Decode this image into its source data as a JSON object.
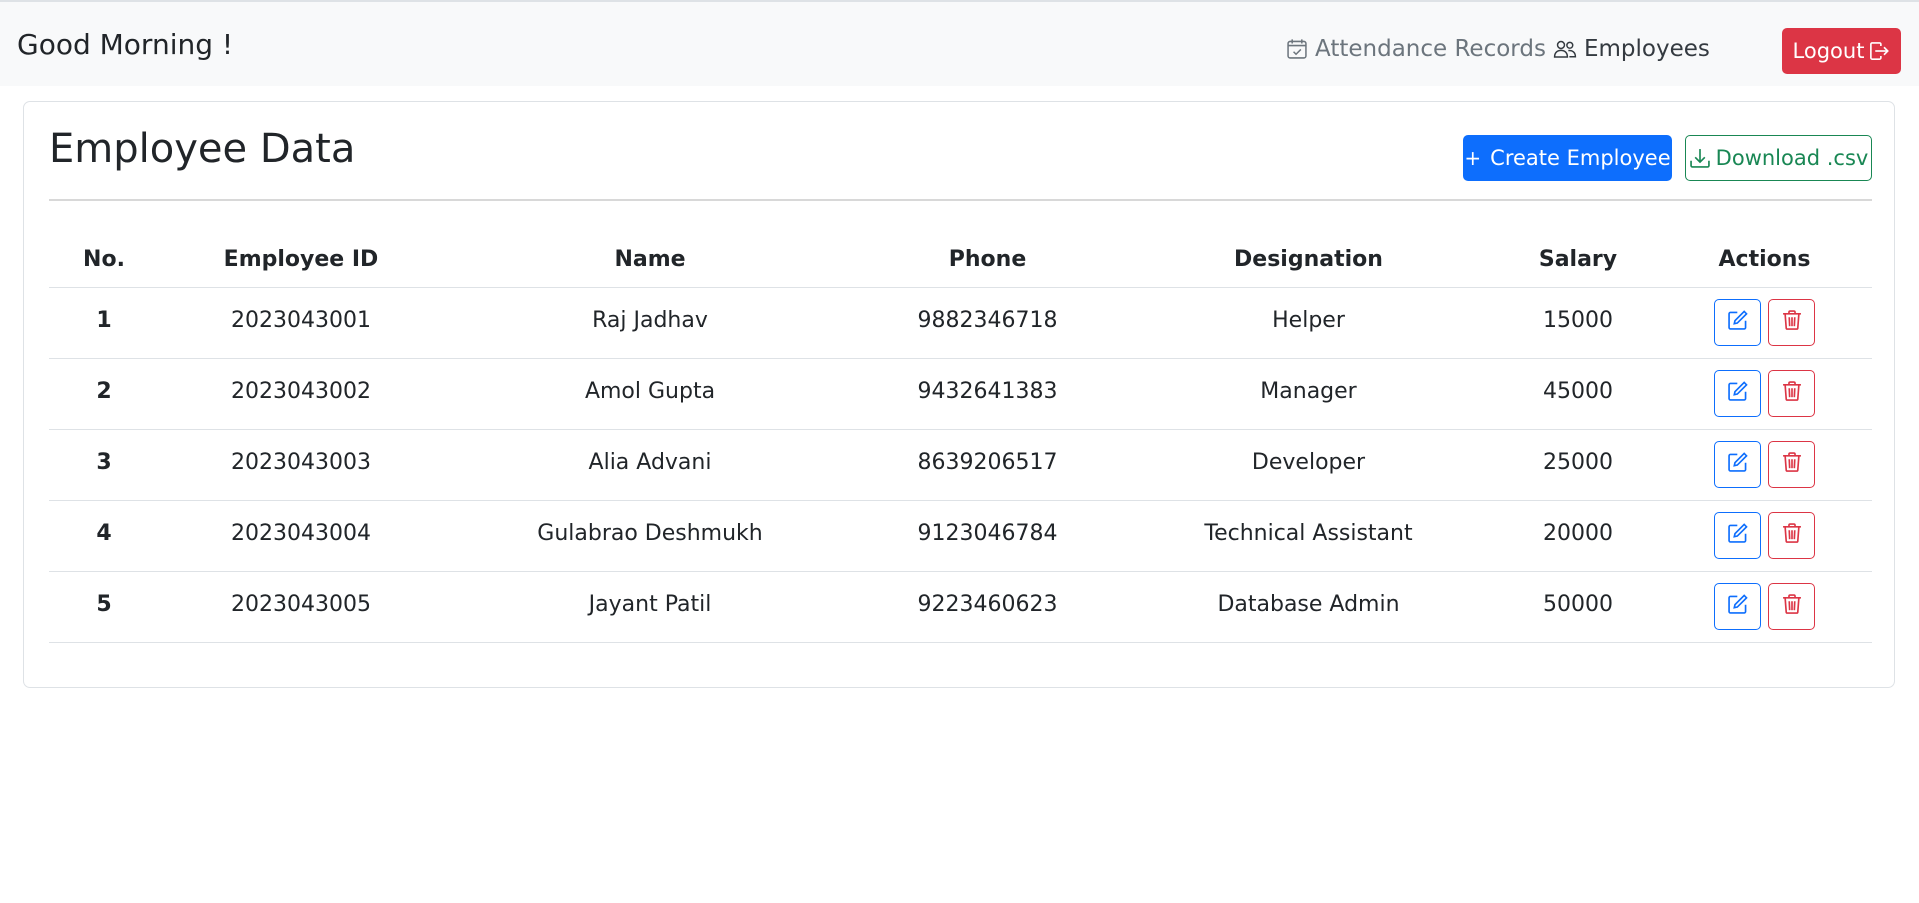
{
  "navbar": {
    "greeting": "Good Morning !",
    "links": [
      {
        "label": "Attendance Records",
        "icon": "calendar-check-icon"
      },
      {
        "label": "Employees",
        "icon": "people-icon"
      }
    ],
    "logout_label": "Logout",
    "logout_icon": "box-arrow-right-icon"
  },
  "main": {
    "title": "Employee Data",
    "create_label": "Create Employee",
    "create_icon": "+",
    "download_label": "Download .csv",
    "download_icon": "download-icon"
  },
  "table": {
    "headers": [
      "No.",
      "Employee ID",
      "Name",
      "Phone",
      "Designation",
      "Salary",
      "Actions"
    ],
    "rows": [
      {
        "no": "1",
        "id": "2023043001",
        "name": "Raj Jadhav",
        "phone": "9882346718",
        "designation": "Helper",
        "salary": "15000"
      },
      {
        "no": "2",
        "id": "2023043002",
        "name": "Amol Gupta",
        "phone": "9432641383",
        "designation": "Manager",
        "salary": "45000"
      },
      {
        "no": "3",
        "id": "2023043003",
        "name": "Alia Advani",
        "phone": "8639206517",
        "designation": "Developer",
        "salary": "25000"
      },
      {
        "no": "4",
        "id": "2023043004",
        "name": "Gulabrao Deshmukh",
        "phone": "9123046784",
        "designation": "Technical Assistant",
        "salary": "20000"
      },
      {
        "no": "5",
        "id": "2023043005",
        "name": "Jayant Patil",
        "phone": "9223460623",
        "designation": "Database Admin",
        "salary": "50000"
      }
    ]
  },
  "colors": {
    "primary": "#0d6efd",
    "danger": "#dc3545",
    "success": "#198754",
    "navbar_bg": "#f8f9fa"
  }
}
